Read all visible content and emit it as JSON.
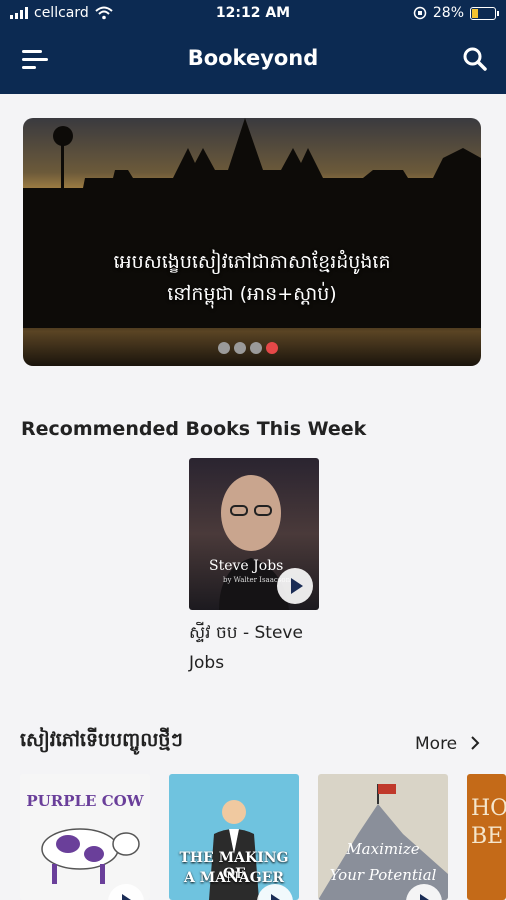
{
  "status_bar": {
    "carrier": "cellcard",
    "time": "12:12 AM",
    "battery": "28%"
  },
  "header": {
    "title": "Bookeyond"
  },
  "banner": {
    "line1": "អេបសង្ខេបសៀវភៅជាភាសាខ្មែរដំបូងគេ",
    "line2": "នៅកម្ពុជា (អាន+ស្តាប់)",
    "slide_count": 4,
    "active_slide": 3
  },
  "recommended": {
    "title": "Recommended Books This Week",
    "book": {
      "cover_title": "Steve Jobs",
      "cover_sub": "by Walter Isaacson",
      "line1": "ស្ទីវ ចប - Steve",
      "line2": "Jobs"
    }
  },
  "new_books": {
    "title": "សៀវភៅទើបបញ្ចូលថ្មីៗ",
    "more_label": "More",
    "books": [
      {
        "cover": "PURPLE COW"
      },
      {
        "cover_line1": "THE MAKING OF",
        "cover_line2": "A MANAGER"
      },
      {
        "cover_line1": "Maximize",
        "cover_line2": "Your Potential"
      },
      {
        "cover_line1": "HO",
        "cover_line2": "BE"
      }
    ]
  },
  "colors": {
    "header": "#0c2a52",
    "active_dot": "#e54848",
    "background": "#f4f4f6"
  }
}
